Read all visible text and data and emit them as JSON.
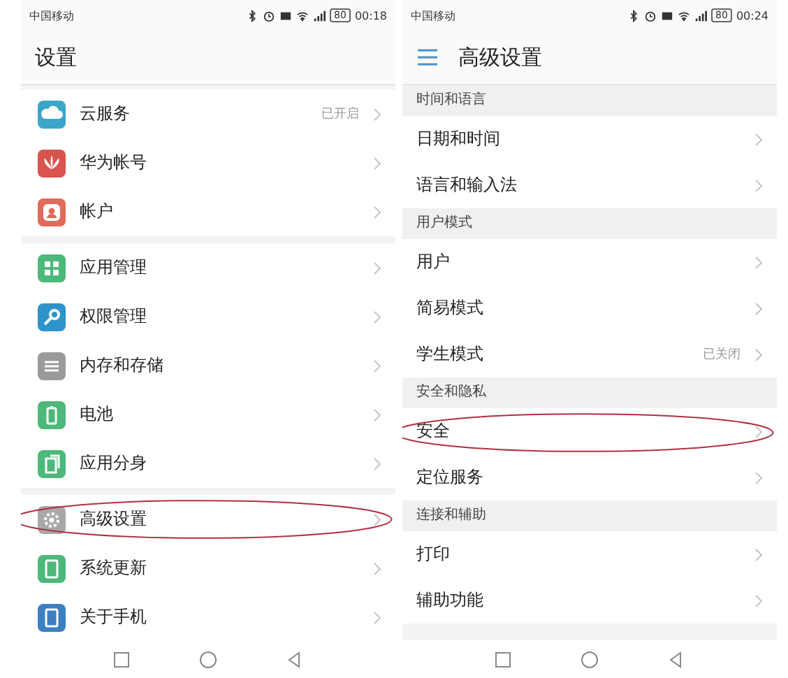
{
  "screens": [
    {
      "status": {
        "carrier": "中国移动",
        "battery": "80",
        "time": "00:18"
      },
      "title": "设置",
      "menu_button": false,
      "groups": [
        {
          "items": [
            {
              "label": "云服务",
              "value": "已开启",
              "color": "#3aa6c8",
              "circled": false
            },
            {
              "label": "华为帐号",
              "color": "#d9534f",
              "circled": false
            },
            {
              "label": "帐户",
              "color": "#e06b5a",
              "circled": false
            }
          ]
        },
        {
          "items": [
            {
              "label": "应用管理",
              "color": "#4cb87a",
              "circled": false
            },
            {
              "label": "权限管理",
              "color": "#2e93c9",
              "circled": false
            },
            {
              "label": "内存和存储",
              "color": "#9a9a9a",
              "circled": false
            },
            {
              "label": "电池",
              "color": "#4cb87a",
              "circled": false
            },
            {
              "label": "应用分身",
              "color": "#4cb87a",
              "circled": false
            }
          ]
        },
        {
          "items": [
            {
              "label": "高级设置",
              "color": "#a8a8a8",
              "circled": true
            },
            {
              "label": "系统更新",
              "color": "#4cb87a",
              "circled": false
            },
            {
              "label": "关于手机",
              "color": "#3b7fc0",
              "circled": false
            }
          ]
        }
      ]
    },
    {
      "status": {
        "carrier": "中国移动",
        "battery": "80",
        "time": "00:24"
      },
      "title": "高级设置",
      "menu_button": true,
      "groups": [
        {
          "header": "时间和语言",
          "items": [
            {
              "label": "日期和时间",
              "circled": false
            },
            {
              "label": "语言和输入法",
              "circled": false
            }
          ]
        },
        {
          "header": "用户模式",
          "items": [
            {
              "label": "用户",
              "circled": false
            },
            {
              "label": "简易模式",
              "circled": false
            },
            {
              "label": "学生模式",
              "value": "已关闭",
              "circled": false
            }
          ]
        },
        {
          "header": "安全和隐私",
          "items": [
            {
              "label": "安全",
              "circled": true
            },
            {
              "label": "定位服务",
              "circled": false
            }
          ]
        },
        {
          "header": "连接和辅助",
          "items": [
            {
              "label": "打印",
              "circled": false
            },
            {
              "label": "辅助功能",
              "circled": false
            }
          ]
        }
      ]
    }
  ]
}
